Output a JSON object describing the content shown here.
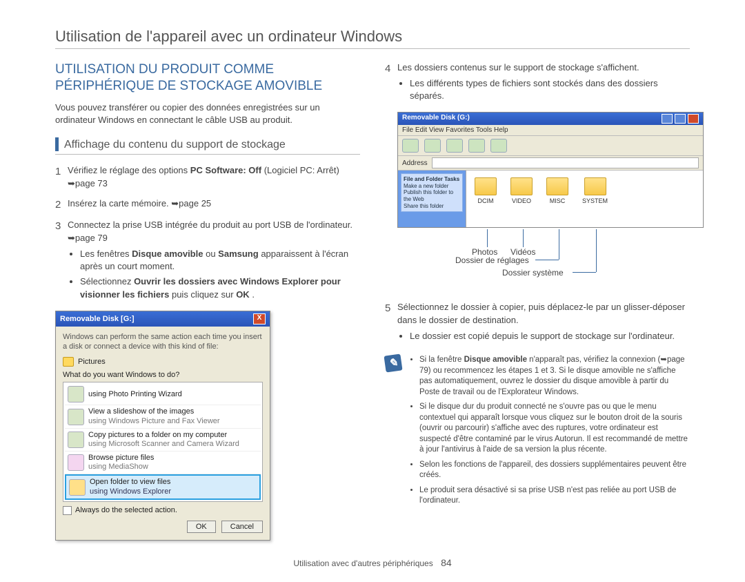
{
  "page_title": "Utilisation de l'appareil avec un ordinateur Windows",
  "section_title": "UTILISATION DU PRODUIT COMME PÉRIPHÉRIQUE DE STOCKAGE AMOVIBLE",
  "intro": "Vous pouvez transférer ou copier des données enregistrées sur un ordinateur Windows en connectant le câble USB au produit.",
  "subhead": "Affichage du contenu du support de stockage",
  "steps_left": [
    {
      "n": "1",
      "text_pre": "Vérifiez le réglage des options ",
      "bold": "PC Software: Off",
      "text_post": " (Logiciel PC: Arrêt) ➥page 73"
    },
    {
      "n": "2",
      "text_pre": "Insérez la carte mémoire. ➥page 25",
      "bold": "",
      "text_post": ""
    },
    {
      "n": "3",
      "text_pre": "Connectez la prise USB intégrée du produit au port USB de l'ordinateur. ➥page 79",
      "bold": "",
      "text_post": "",
      "bullets": [
        {
          "pre": "Les fenêtres ",
          "b1": "Disque amovible",
          "mid": " ou ",
          "b2": "Samsung",
          "post": " apparaissent à l'écran après un court moment."
        },
        {
          "pre": "Sélectionnez ",
          "b1": "Ouvrir les dossiers avec Windows Explorer pour visionner les fichiers",
          "mid": " puis cliquez sur ",
          "b2": "OK",
          "post": "."
        }
      ]
    }
  ],
  "dlg": {
    "title": "Removable Disk [G:]",
    "line1": "Windows can perform the same action each time you insert a disk or connect a device with this kind of file:",
    "pictures": "Pictures",
    "line2": "What do you want Windows to do?",
    "items": [
      {
        "l1": "using Photo Printing Wizard",
        "l2": ""
      },
      {
        "l1": "View a slideshow of the images",
        "l2": "using Windows Picture and Fax Viewer"
      },
      {
        "l1": "Copy pictures to a folder on my computer",
        "l2": "using Microsoft Scanner and Camera Wizard"
      },
      {
        "l1": "Browse picture files",
        "l2": "using MediaShow"
      },
      {
        "l1": "Open folder to view files",
        "l2": "using Windows Explorer",
        "sel": true
      }
    ],
    "chk": "Always do the selected action.",
    "ok": "OK",
    "cancel": "Cancel"
  },
  "step4": {
    "n": "4",
    "text": "Les dossiers contenus sur le support de stockage s'affichent.",
    "bullet": "Les différents types de fichiers sont stockés dans des dossiers séparés."
  },
  "explorer": {
    "title": "Removable Disk (G:)",
    "menu": "File  Edit  View  Favorites  Tools  Help",
    "side_title": "File and Folder Tasks",
    "side_items": [
      "Make a new folder",
      "Publish this folder to the Web",
      "Share this folder"
    ],
    "folders": [
      "DCIM",
      "VIDEO",
      "MISC",
      "SYSTEM"
    ]
  },
  "callouts": {
    "photos": "Photos",
    "videos": "Vidéos",
    "settings": "Dossier de réglages",
    "system": "Dossier système"
  },
  "step5": {
    "n": "5",
    "text": "Sélectionnez le dossier à copier, puis déplacez-le par un glisser-déposer dans le dossier de destination.",
    "bullet": "Le dossier est copié depuis le support de stockage sur l'ordinateur."
  },
  "notes": [
    "Si la fenêtre Disque amovible n'apparaît pas, vérifiez la connexion (➥page 79) ou recommencez les étapes 1 et 3. Si le disque amovible ne s'affiche pas automatiquement, ouvrez le dossier du disque amovible à partir du Poste de travail ou de l'Explorateur Windows.",
    "Si le disque dur du produit connecté ne s'ouvre pas ou que le menu contextuel qui apparaît lorsque vous cliquez sur le bouton droit de la souris (ouvrir ou parcourir) s'affiche avec des ruptures, votre ordinateur est suspecté d'être contaminé par le virus Autorun. Il est recommandé de mettre à jour l'antivirus à l'aide de sa version la plus récente.",
    "Selon les fonctions de l'appareil, des dossiers supplémentaires peuvent être créés.",
    "Le produit sera désactivé si sa prise USB n'est pas reliée au port USB de l'ordinateur."
  ],
  "note_bold_0": "Disque amovible",
  "footer": {
    "text": "Utilisation avec d'autres périphériques",
    "page": "84"
  }
}
